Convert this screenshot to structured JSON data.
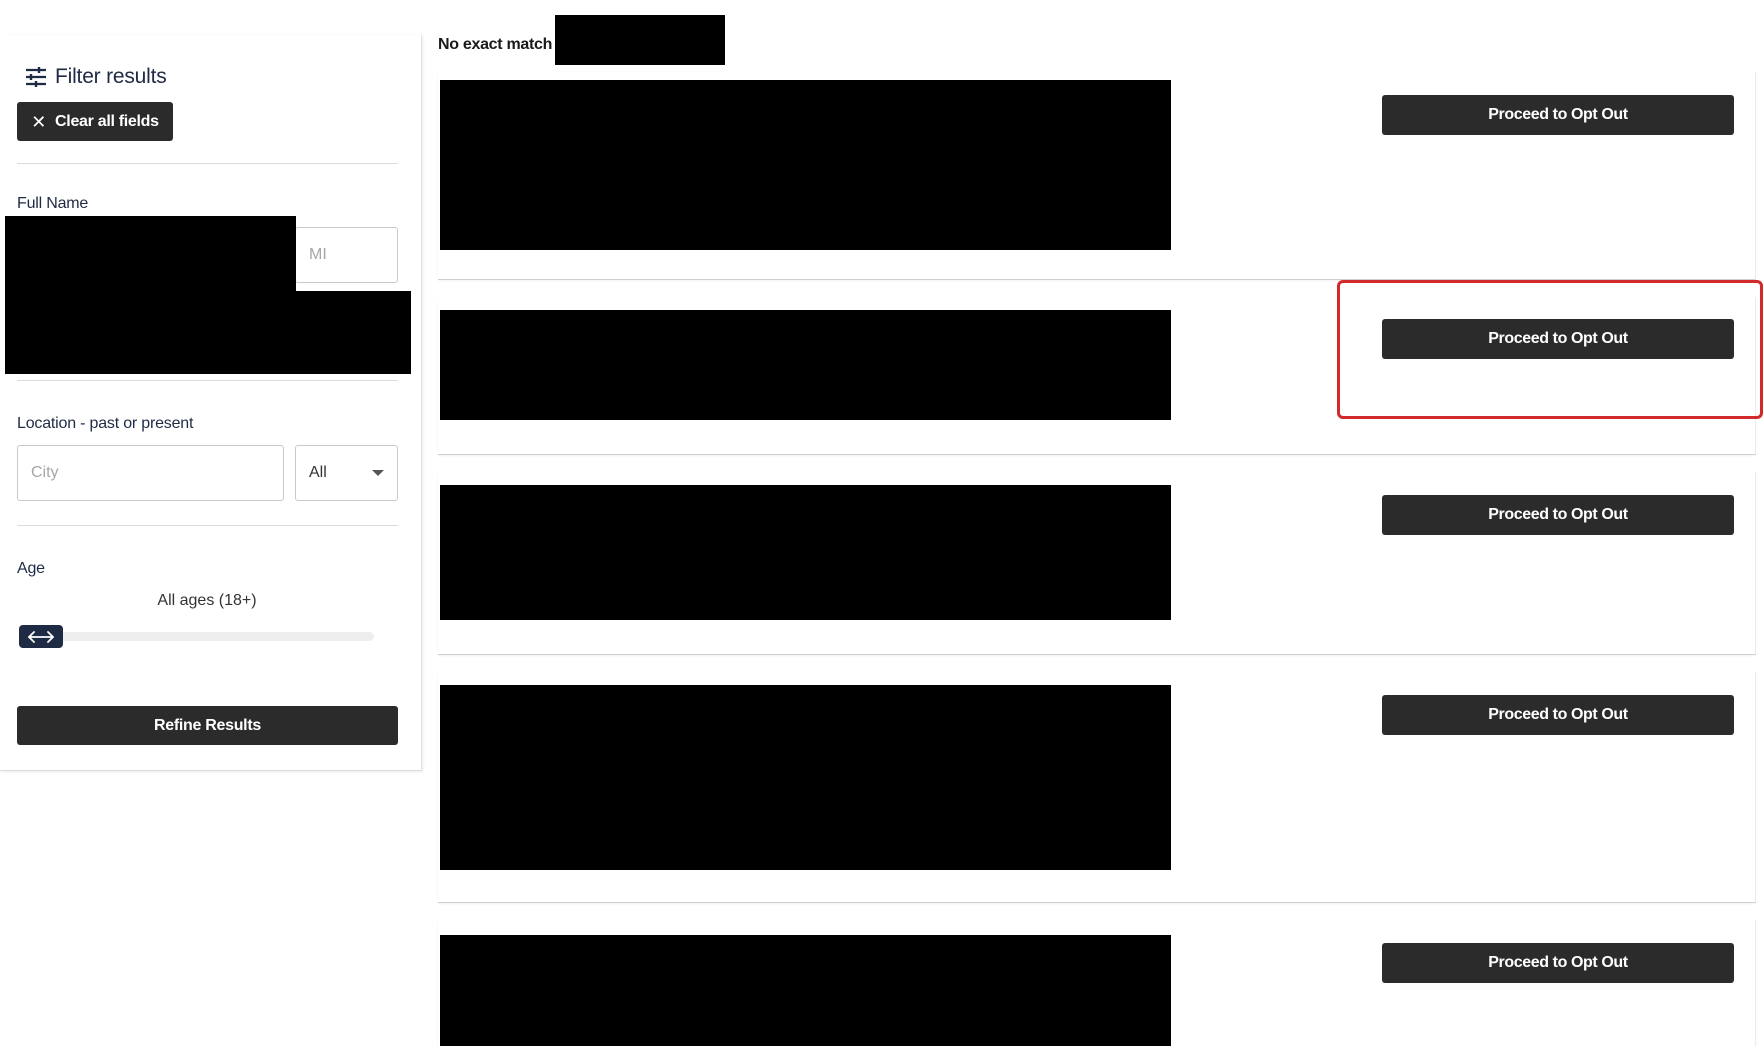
{
  "sidebar": {
    "title": "Filter results",
    "clear_button": "Clear all fields",
    "full_name_label": "Full Name",
    "mi_placeholder": "MI",
    "location_label": "Location - past or present",
    "city_placeholder": "City",
    "state_select_value": "All",
    "age_label": "Age",
    "age_value": "All ages (18+)",
    "refine_button": "Refine Results"
  },
  "results": {
    "no_match_text": "No exact match f",
    "cards": [
      {
        "button_label": "Proceed to Opt Out"
      },
      {
        "button_label": "Proceed to Opt Out"
      },
      {
        "button_label": "Proceed to Opt Out"
      },
      {
        "button_label": "Proceed to Opt Out"
      },
      {
        "button_label": "Proceed to Opt Out"
      }
    ]
  },
  "icons": {
    "filter": "sliders-icon",
    "clear": "close-icon",
    "select": "caret-down-icon",
    "slider_handle": "left-right-arrow-icon"
  },
  "colors": {
    "button_bg": "#2b2b2b",
    "accent_navy": "#1f2a44",
    "highlight": "#d22a2a"
  }
}
